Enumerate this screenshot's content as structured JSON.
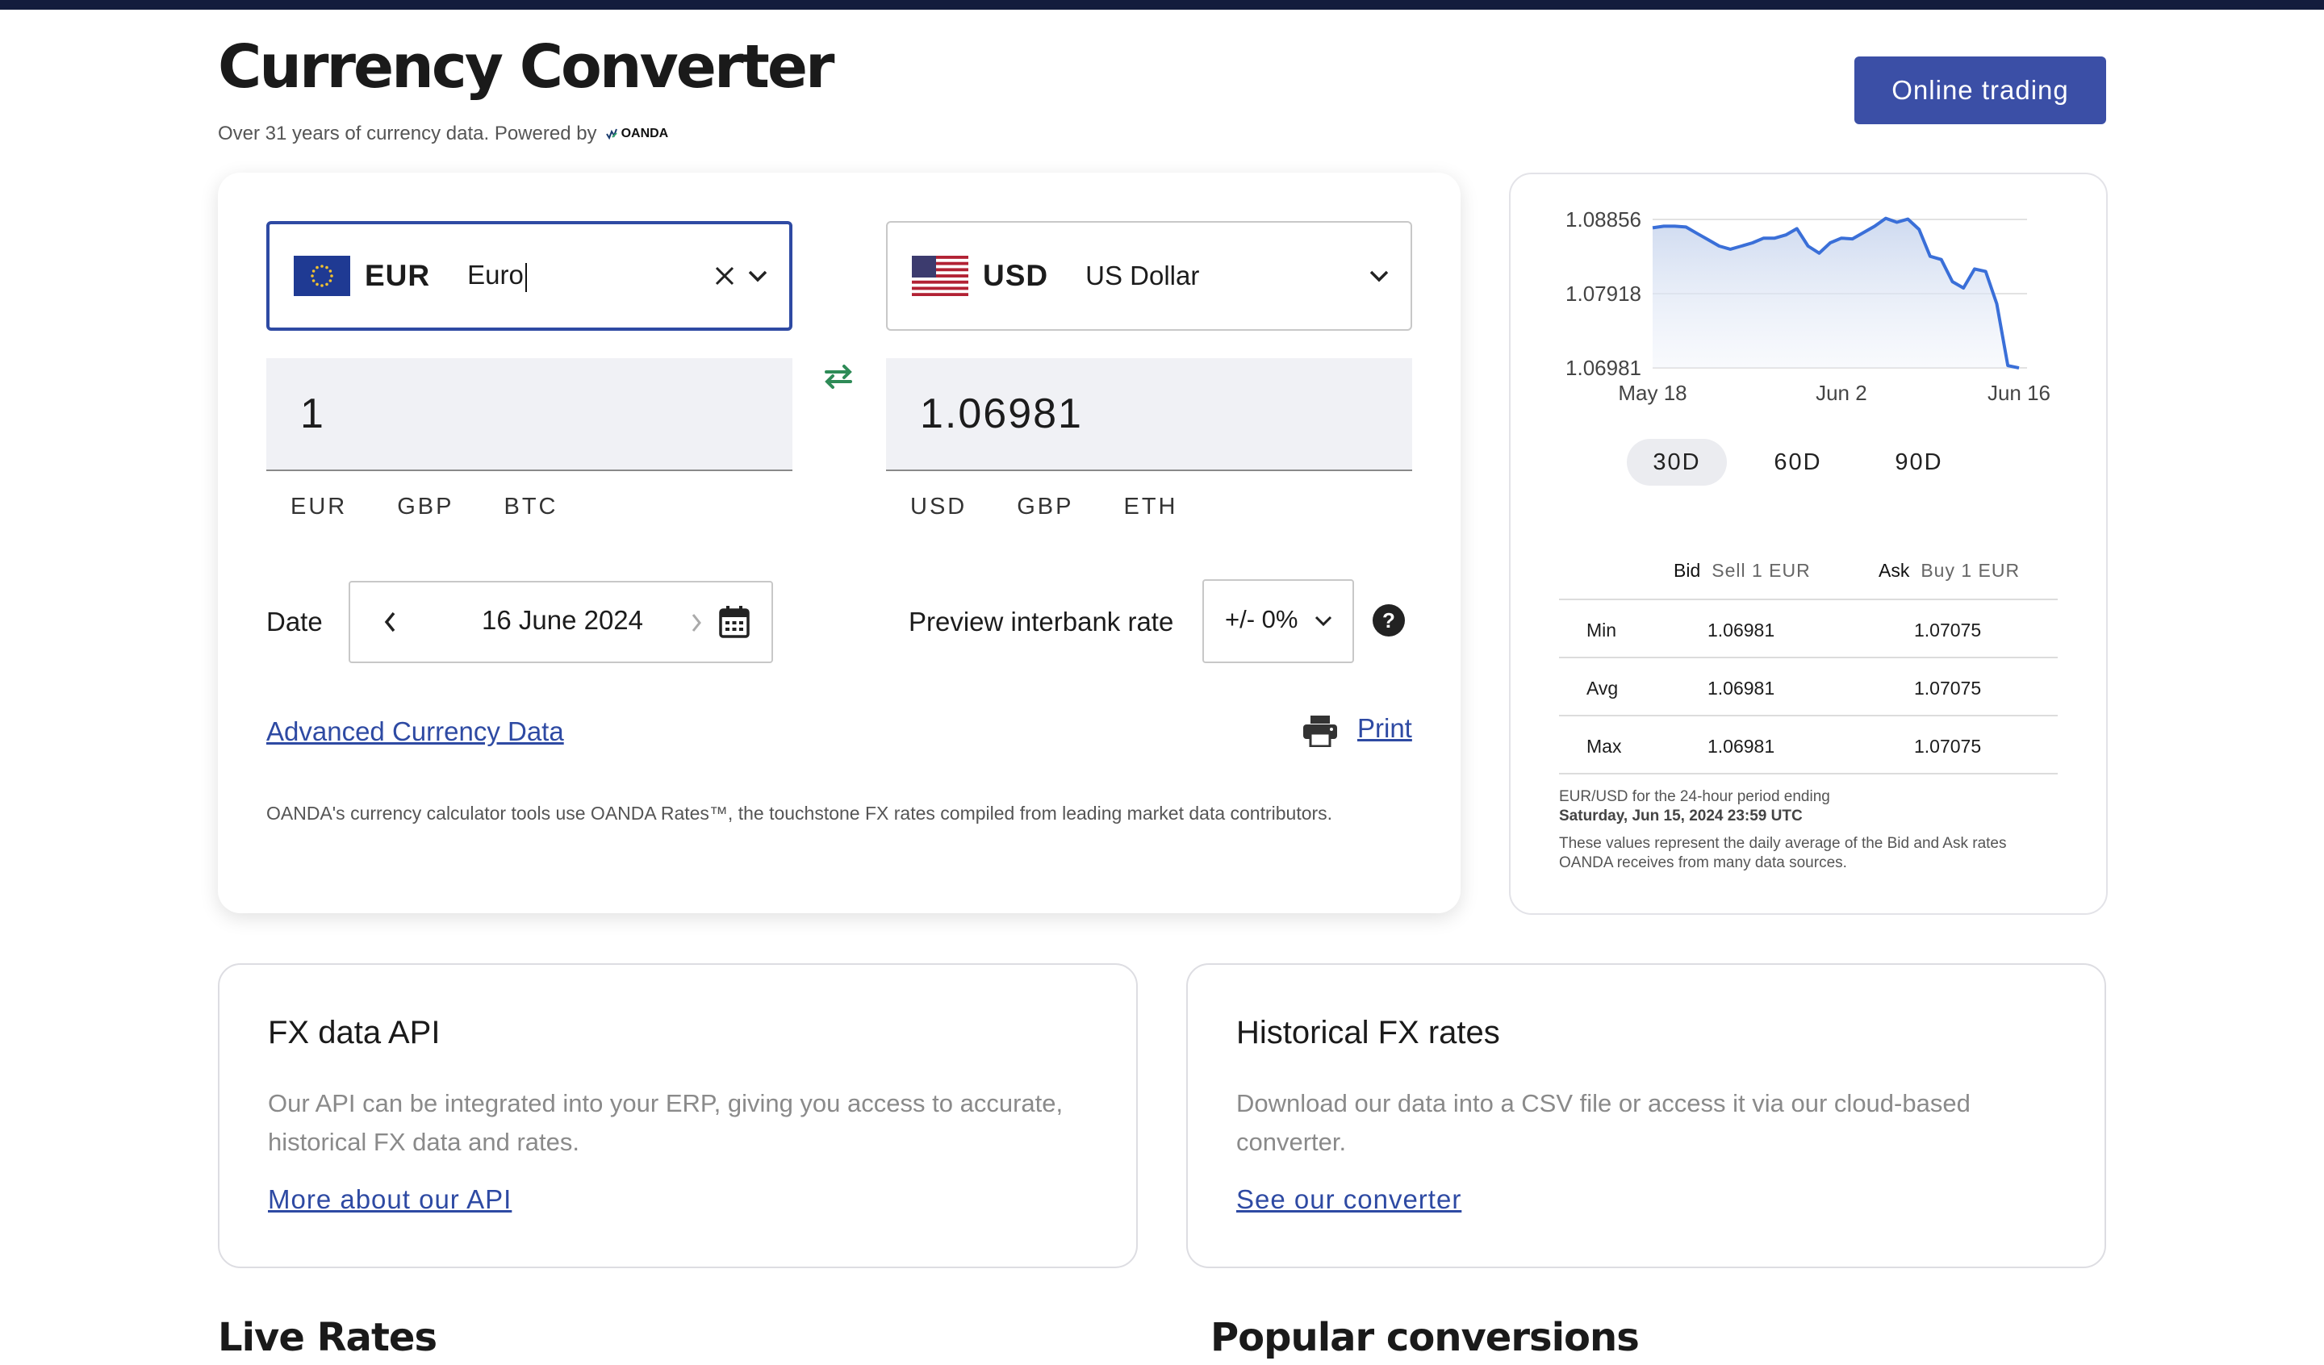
{
  "header": {
    "title": "Currency Converter",
    "subtitle": "Over 31 years of currency data. Powered by",
    "logo_text": "OANDA",
    "cta_label": "Online trading"
  },
  "converter": {
    "from": {
      "code": "EUR",
      "name": "Euro",
      "amount": "1",
      "quick": [
        "EUR",
        "GBP",
        "BTC"
      ]
    },
    "to": {
      "code": "USD",
      "name": "US Dollar",
      "amount": "1.06981",
      "quick": [
        "USD",
        "GBP",
        "ETH"
      ]
    },
    "date_label": "Date",
    "date_value": "16 June 2024",
    "preview_label": "Preview interbank rate",
    "rate_value": "+/- 0%",
    "advanced_link": "Advanced Currency Data",
    "print_label": "Print",
    "disclaimer": "OANDA's currency calculator tools use OANDA Rates™, the touchstone FX rates compiled from leading market data contributors."
  },
  "chart_data": {
    "type": "area",
    "title": "",
    "xlabel": "",
    "ylabel": "",
    "y_ticks": [
      "1.08856",
      "1.07918",
      "1.06981"
    ],
    "x_ticks": [
      "May 18",
      "Jun 2",
      "Jun 16"
    ],
    "ylim": [
      1.06981,
      1.08856
    ],
    "grid": true,
    "line_color": "#3a6fd8",
    "series": [
      {
        "values": [
          1.0875,
          1.0877,
          1.0877,
          1.0876,
          1.0868,
          1.086,
          1.0852,
          1.0848,
          1.0852,
          1.0856,
          1.0862,
          1.0862,
          1.0866,
          1.0874,
          1.0852,
          1.0843,
          1.0856,
          1.0862,
          1.0861,
          1.0869,
          1.0877,
          1.0887,
          1.0882,
          1.0886,
          1.0873,
          1.0839,
          1.0835,
          1.0807,
          1.0799,
          1.0823,
          1.082,
          1.0779,
          1.0701,
          1.0698
        ]
      }
    ]
  },
  "range_tabs": [
    "30D",
    "60D",
    "90D"
  ],
  "range_active": "30D",
  "rates_table": {
    "bid_label": "Bid",
    "bid_sub": "Sell 1 EUR",
    "ask_label": "Ask",
    "ask_sub": "Buy 1 EUR",
    "rows": [
      {
        "label": "Min",
        "bid": "1.06981",
        "ask": "1.07075"
      },
      {
        "label": "Avg",
        "bid": "1.06981",
        "ask": "1.07075"
      },
      {
        "label": "Max",
        "bid": "1.06981",
        "ask": "1.07075"
      }
    ]
  },
  "chart_note": {
    "line1": "EUR/USD for the 24-hour period ending",
    "line2": "Saturday, Jun 15, 2024 23:59 UTC",
    "line3": "These values represent the daily average of the Bid and Ask rates OANDA receives from many data sources."
  },
  "cards": [
    {
      "title": "FX data API",
      "body": "Our API can be integrated into your ERP, giving you access to accurate, historical FX data and rates.",
      "link": "More about our API"
    },
    {
      "title": "Historical FX rates",
      "body": "Download our data into a CSV file or access it via our cloud-based converter.",
      "link": "See our converter"
    }
  ],
  "sections": {
    "live_rates": "Live Rates",
    "popular": "Popular conversions"
  }
}
